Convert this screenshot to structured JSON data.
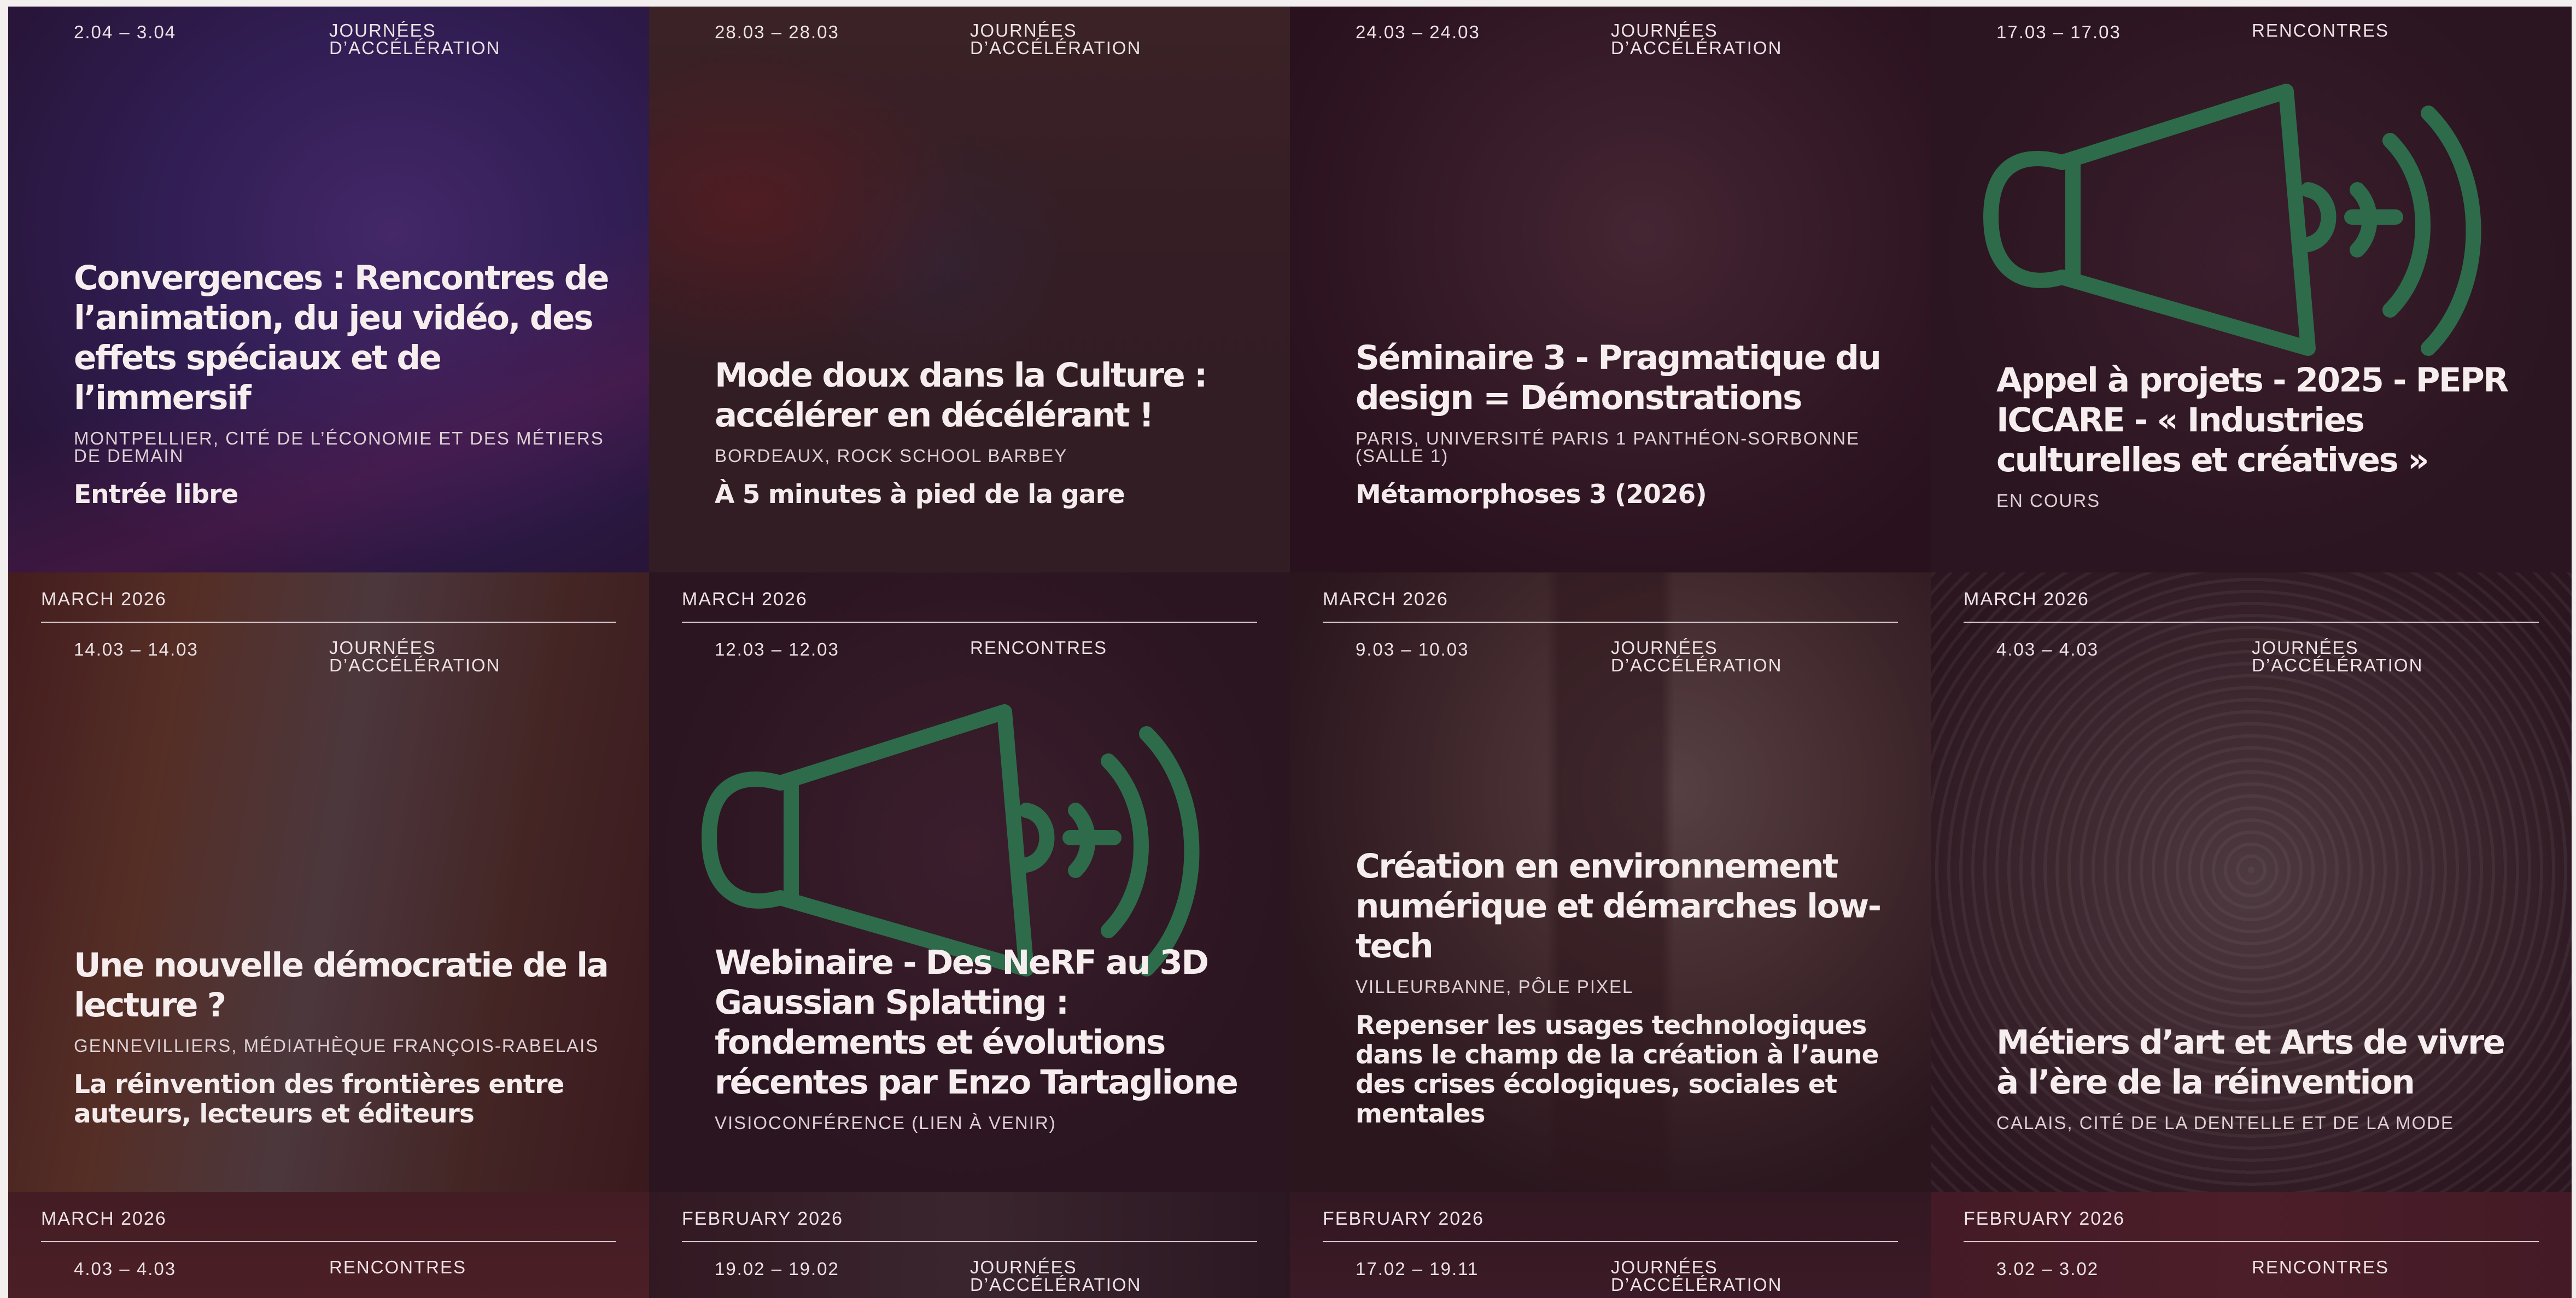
{
  "colors": {
    "background": "#f3efee",
    "card_dark": "#2b1620",
    "megaphone_green": "#2d6b4a",
    "text": "#f6eeee"
  },
  "cards": [
    {
      "month": "",
      "dates": "2.04 – 3.04",
      "category": "JOURNÉES D’ACCÉLÉRATION",
      "title": "Convergences : Rencontres de l’animation, du jeu vidéo, des effets spéciaux et de l’immersif",
      "location": "MONTPELLIER, CITÉ DE L’ÉCONOMIE ET DES MÉTIERS DE DEMAIN",
      "note": "Entrée libre"
    },
    {
      "month": "",
      "dates": "28.03 – 28.03",
      "category": "JOURNÉES D’ACCÉLÉRATION",
      "title": "Mode doux dans la Culture : accélérer en décélérant !",
      "location": "BORDEAUX, ROCK SCHOOL BARBEY",
      "note": "À 5 minutes à pied de la gare"
    },
    {
      "month": "",
      "dates": "24.03 – 24.03",
      "category": "JOURNÉES D’ACCÉLÉRATION",
      "title": "Séminaire 3 - Pragmatique du design = Démonstrations",
      "location": "PARIS, UNIVERSITÉ PARIS 1 PANTHÉON-SORBONNE (SALLE 1)",
      "note": "Métamorphoses 3 (2026)"
    },
    {
      "month": "",
      "dates": "17.03 – 17.03",
      "category": "RENCONTRES",
      "title": "Appel à projets - 2025 - PEPR ICCARE - « Industries culturelles et créatives »",
      "location": "EN COURS",
      "note": "",
      "icon": "megaphone-icon"
    },
    {
      "month": "MARCH 2026",
      "dates": "14.03 – 14.03",
      "category": "JOURNÉES D’ACCÉLÉRATION",
      "title": "Une nouvelle démocratie de la lecture ?",
      "location": "GENNEVILLIERS, MÉDIATHÈQUE FRANÇOIS-RABELAIS",
      "note": "La réinvention des frontières entre auteurs, lecteurs et éditeurs"
    },
    {
      "month": "MARCH 2026",
      "dates": "12.03 – 12.03",
      "category": "RENCONTRES",
      "title": "Webinaire - Des NeRF au 3D Gaussian Splatting : fondements et évolutions récentes par Enzo Tartaglione",
      "location": "VISIOCONFÉRENCE (LIEN À VENIR)",
      "note": "",
      "icon": "megaphone-icon"
    },
    {
      "month": "MARCH 2026",
      "dates": "9.03 – 10.03",
      "category": "JOURNÉES D’ACCÉLÉRATION",
      "title": "Création en environnement numérique et démarches low-tech",
      "location": "VILLEURBANNE, PÔLE PIXEL",
      "note": "Repenser les usages technologiques dans le champ de la création à l’aune des crises écologiques, sociales et mentales"
    },
    {
      "month": "MARCH 2026",
      "dates": "4.03 – 4.03",
      "category": "JOURNÉES D’ACCÉLÉRATION",
      "title": "Métiers d’art et Arts de vivre à l’ère de la réinvention",
      "location": "CALAIS, CITÉ DE LA DENTELLE ET DE LA MODE",
      "note": ""
    },
    {
      "month": "MARCH 2026",
      "dates": "4.03 – 4.03",
      "category": "RENCONTRES",
      "title": "",
      "location": "",
      "note": ""
    },
    {
      "month": "FEBRUARY 2026",
      "dates": "19.02 – 19.02",
      "category": "JOURNÉES D’ACCÉLÉRATION",
      "title": "",
      "location": "",
      "note": ""
    },
    {
      "month": "FEBRUARY 2026",
      "dates": "17.02 – 19.11",
      "category": "JOURNÉES D’ACCÉLÉRATION",
      "title": "",
      "location": "",
      "note": ""
    },
    {
      "month": "FEBRUARY 2026",
      "dates": "3.02 – 3.02",
      "category": "RENCONTRES",
      "title": "",
      "location": "",
      "note": ""
    }
  ]
}
